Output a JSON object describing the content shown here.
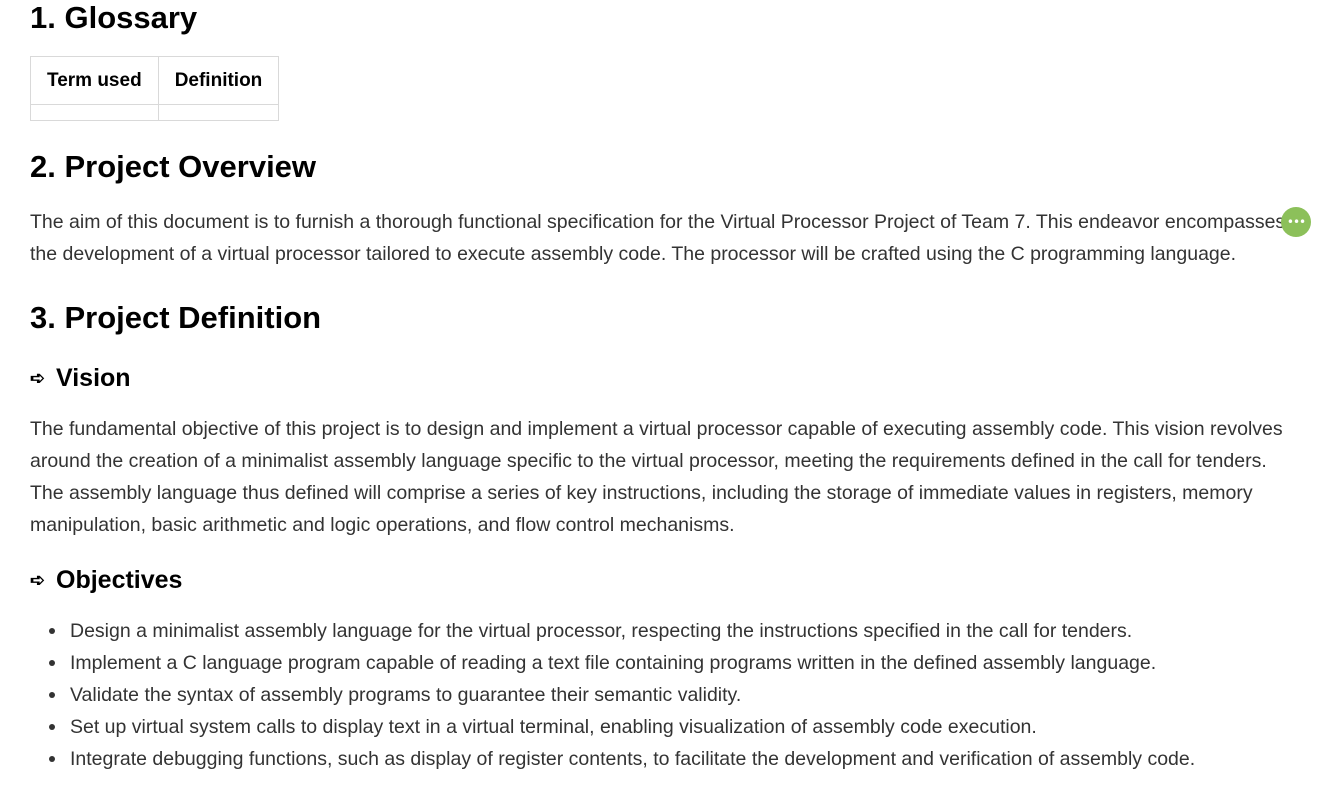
{
  "sections": {
    "glossary": {
      "title": "1. Glossary",
      "table": {
        "headers": [
          "Term used",
          "Definition"
        ],
        "rows": [
          [
            "",
            ""
          ]
        ]
      }
    },
    "overview": {
      "title": "2. Project Overview",
      "text": "The aim of this document is to furnish a thorough functional specification for the Virtual Processor Project of Team 7. This endeavor encompasses the development of a virtual processor tailored to execute assembly code. The processor will be crafted using the C programming language."
    },
    "definition": {
      "title": "3. Project Definition",
      "vision": {
        "arrow": "➪",
        "title": "Vision",
        "text": "The fundamental objective of this project is to design and implement a virtual processor capable of executing assembly code. This vision revolves around the creation of a minimalist assembly language specific to the virtual processor, meeting the requirements defined in the call for tenders. The assembly language thus defined will comprise a series of key instructions, including the storage of immediate values in registers, memory manipulation, basic arithmetic and logic operations, and flow control mechanisms."
      },
      "objectives": {
        "arrow": "➪",
        "title": "Objectives",
        "items": [
          "Design a minimalist assembly language for the virtual processor, respecting the instructions specified in the call for tenders.",
          "Implement a C language program capable of reading a text file containing programs written in the defined assembly language.",
          "Validate the syntax of assembly programs to guarantee their semantic validity.",
          "Set up virtual system calls to display text in a virtual terminal, enabling visualization of assembly code execution.",
          "Integrate debugging functions, such as display of register contents, to facilitate the development and verification of assembly code."
        ]
      }
    }
  },
  "comment_button": {
    "label": "•••",
    "icon": "more-dots-icon",
    "color": "#8cc05a"
  }
}
